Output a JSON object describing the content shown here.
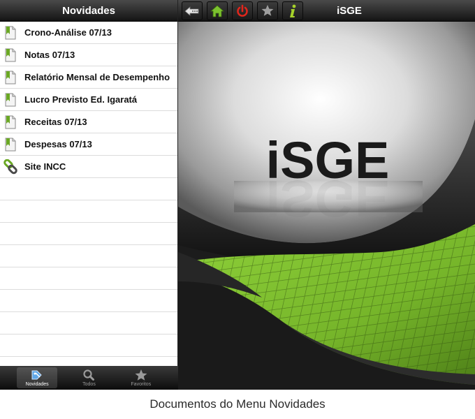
{
  "sidebar": {
    "title": "Novidades",
    "items": [
      {
        "label": "Crono-Análise 07/13",
        "icon": "document-bookmark-icon"
      },
      {
        "label": "Notas 07/13",
        "icon": "document-bookmark-icon"
      },
      {
        "label": "Relatório Mensal de Desempenho",
        "icon": "document-bookmark-icon"
      },
      {
        "label": "Lucro Previsto Ed. Igaratá",
        "icon": "document-bookmark-icon"
      },
      {
        "label": "Receitas 07/13",
        "icon": "document-bookmark-icon"
      },
      {
        "label": "Despesas 07/13",
        "icon": "document-bookmark-icon"
      },
      {
        "label": "Site INCC",
        "icon": "chain-link-icon"
      }
    ]
  },
  "tabbar": {
    "tabs": [
      {
        "label": "Novidades",
        "icon": "news-icon",
        "active": true
      },
      {
        "label": "Todos",
        "icon": "magnifier-icon",
        "active": false
      },
      {
        "label": "Favoritos",
        "icon": "star-icon",
        "active": false
      }
    ]
  },
  "toolbar": {
    "buttons": [
      "back-arrow-icon",
      "home-icon",
      "power-icon",
      "star-icon",
      "info-icon"
    ]
  },
  "main": {
    "title": "iSGE",
    "logo_text": "iSGE"
  },
  "caption": "Documentos do Menu Novidades",
  "colors": {
    "accent_green": "#7cb82f",
    "power_red": "#e0261c",
    "header_dark": "#1a1a1a"
  }
}
